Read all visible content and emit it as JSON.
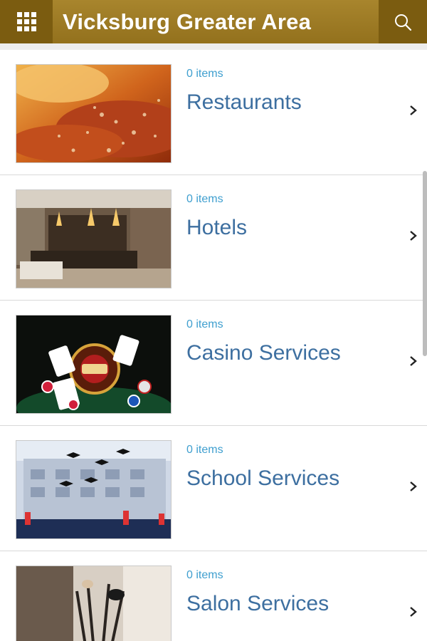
{
  "header": {
    "title": "Vicksburg Greater Area",
    "menu_icon": "grid-menu-icon",
    "search_icon": "search-icon",
    "background": "#93711d",
    "button_background": "#7b5c10"
  },
  "categories": [
    {
      "name": "Restaurants",
      "count": "0 items",
      "image": "food-photo"
    },
    {
      "name": "Hotels",
      "count": "0 items",
      "image": "hotel-lobby-photo"
    },
    {
      "name": "Casino Services",
      "count": "0 items",
      "image": "casino-roulette-photo"
    },
    {
      "name": "School Services",
      "count": "0 items",
      "image": "graduation-photo"
    },
    {
      "name": "Salon Services",
      "count": "0 items",
      "image": "salon-brushes-photo"
    }
  ],
  "colors": {
    "count_text": "#3f9fcf",
    "name_text": "#3d6fa0"
  }
}
